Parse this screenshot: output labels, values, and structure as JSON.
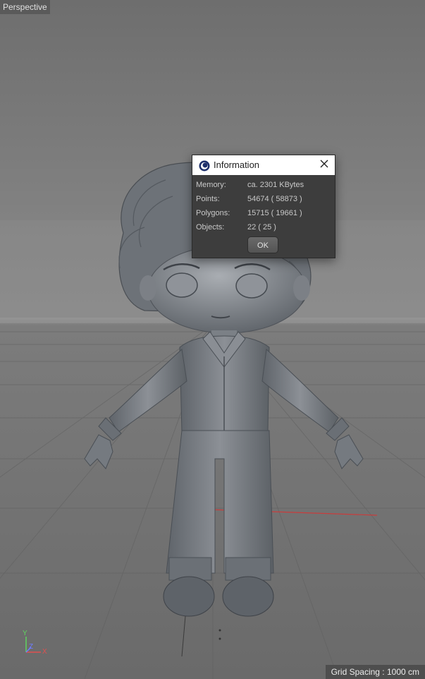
{
  "viewport": {
    "label": "Perspective"
  },
  "dialog": {
    "title": "Information",
    "app_icon": "cinema4d-icon",
    "close_icon": "close-icon",
    "rows": [
      {
        "label": "Memory:",
        "value": "ca. 2301 KBytes"
      },
      {
        "label": "Points:",
        "value": "54674 ( 58873 )"
      },
      {
        "label": "Polygons:",
        "value": "15715 ( 19661 )"
      },
      {
        "label": "Objects:",
        "value": "22 ( 25 )"
      }
    ],
    "ok_label": "OK"
  },
  "axes": {
    "y": "Y",
    "z": "Z",
    "x": "X"
  },
  "status": {
    "grid_spacing": "Grid Spacing : 1000 cm"
  },
  "colors": {
    "axis_x": "#e05050",
    "axis_y": "#5fd35f",
    "axis_z": "#6f7cff",
    "dialog_bg": "#3d3d3d"
  }
}
